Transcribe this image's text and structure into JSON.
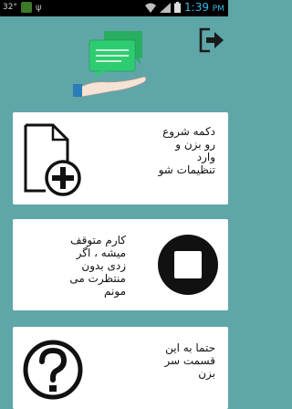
{
  "statusbar": {
    "temperature": "32°",
    "time": "1:39",
    "time_suffix": "PM"
  },
  "cards": [
    {
      "label": "دکمه شروع\nرو بزن و\nوارد\nتنظیمات شو",
      "icon": "add-file-icon"
    },
    {
      "label": "کارم متوقف\nمیشه ، اگر\nزدی بدون\nمنتظرت می\nمونم",
      "icon": "stop-icon"
    },
    {
      "label": "حتما به این\nقسمت سر\nبزن",
      "icon": "help-icon"
    }
  ],
  "colors": {
    "background": "#5fa6a8",
    "card": "#ffffff",
    "illustration_green": "#2ecc71",
    "time_blue": "#3bb8e8"
  }
}
